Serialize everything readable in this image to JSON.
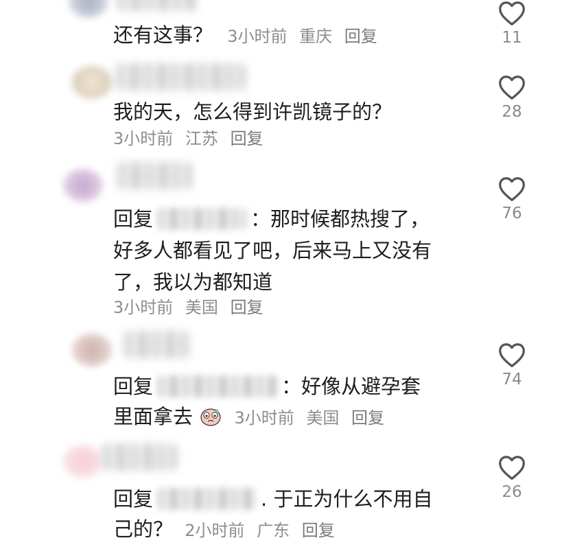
{
  "comments": [
    {
      "text": "还有这事？",
      "meta": {
        "time": "3小时前",
        "location": "重庆",
        "reply": "回复"
      },
      "likes": "11"
    },
    {
      "text": "我的天，怎么得到许凯镜子的？",
      "meta": {
        "time": "3小时前",
        "location": "江苏",
        "reply": "回复"
      },
      "likes": "28"
    },
    {
      "reply_prefix": "回复",
      "text_line1": "：那时候都热搜了，",
      "text_line2": "好多人都看见了吧，后来马上又没有",
      "text_line3": "了，我以为都知道",
      "meta": {
        "time": "3小时前",
        "location": "美国",
        "reply": "回复"
      },
      "likes": "76"
    },
    {
      "reply_prefix": "回复",
      "text_line1": "：好像从避孕套",
      "text_line2": "里面拿去",
      "meta": {
        "time": "3小时前",
        "location": "美国",
        "reply": "回复"
      },
      "likes": "74"
    },
    {
      "reply_prefix": "回复",
      "text_line1": ". 于正为什么不用自",
      "text_line2": "己的？",
      "meta": {
        "time": "2小时前",
        "location": "广东",
        "reply": "回复"
      },
      "likes": "26"
    }
  ],
  "icons": {
    "like": "heart-outline-icon",
    "emoji": "crying-face-emoji"
  },
  "colors": {
    "text": "#1d1d1d",
    "meta": "#8d8d8d",
    "heart": "#555555"
  }
}
